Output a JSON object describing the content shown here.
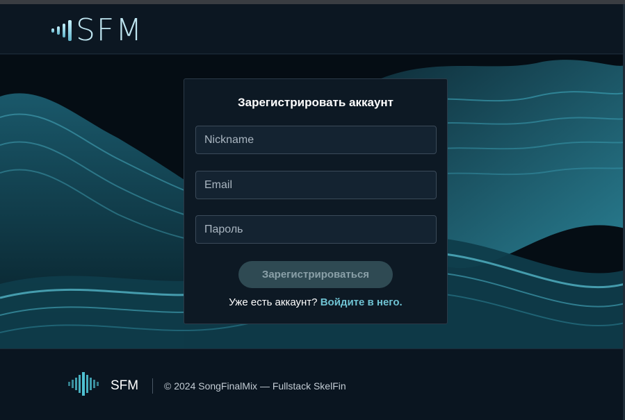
{
  "brand": {
    "logo_text": "SFM"
  },
  "register": {
    "title": "Зарегистрировать аккаунт",
    "nickname_placeholder": "Nickname",
    "email_placeholder": "Email",
    "password_placeholder": "Пароль",
    "submit_label": "Зарегистрироваться",
    "login_prompt": "Уже есть аккаунт?",
    "login_link": "Войдите в него."
  },
  "footer": {
    "brand": "SFM",
    "copyright": "© 2024 SongFinalMix — Fullstack SkelFin"
  },
  "colors": {
    "accent": "#6fc3d3",
    "background": "#0a1520",
    "card": "#0d1924"
  },
  "icons": [
    "sound-bars-icon",
    "equalizer-logo-icon"
  ]
}
